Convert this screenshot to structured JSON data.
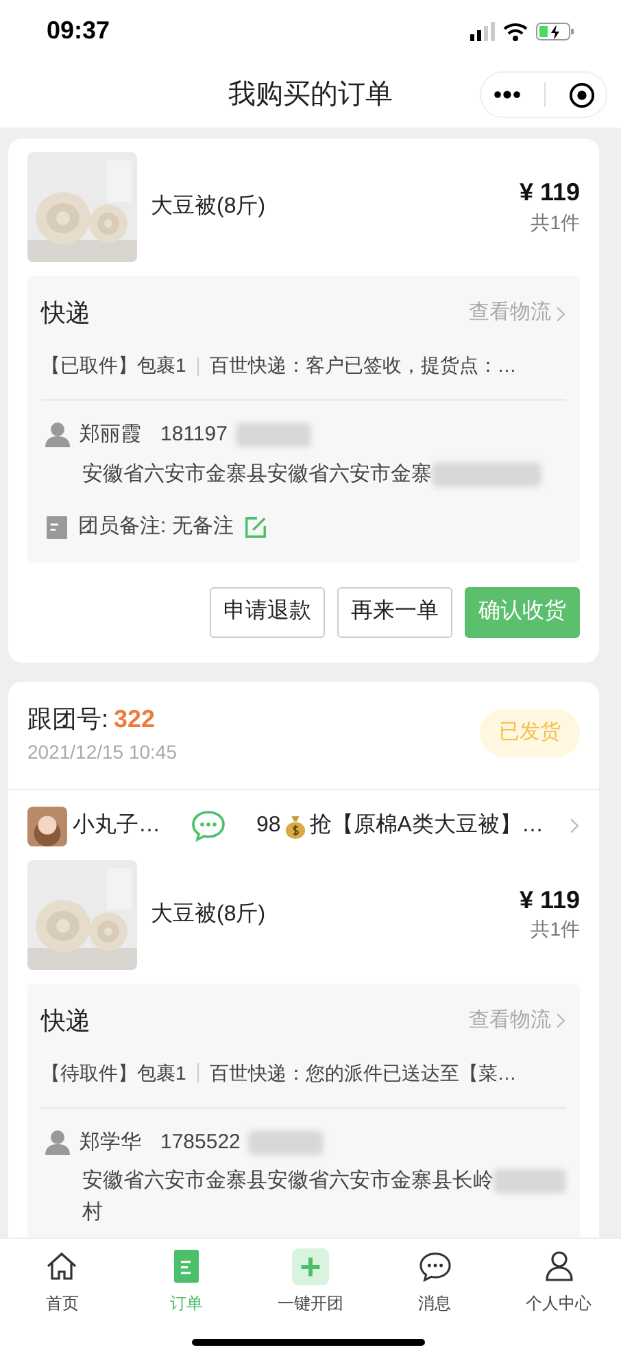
{
  "status_bar": {
    "time": "09:37"
  },
  "header": {
    "title": "我购买的订单"
  },
  "orders": [
    {
      "product": {
        "name": "大豆被(8斤)",
        "price": "¥ 119",
        "count": "共1件"
      },
      "express": {
        "title": "快递",
        "link": "查看物流",
        "status": "【已取件】包裹1",
        "detail": "百世快递：客户已签收，提货点：…",
        "name": "郑丽霞",
        "phone": "181197",
        "address": "安徽省六安市金寨县安徽省六安市金寨",
        "redacted": true,
        "note": "团员备注: 无备注"
      },
      "actions": [
        {
          "label": "申请退款",
          "kind": "outline"
        },
        {
          "label": "再来一单",
          "kind": "outline"
        },
        {
          "label": "确认收货",
          "kind": "primary"
        }
      ]
    },
    {
      "header": {
        "label": "跟团号:",
        "number": "322",
        "time": "2021/12/15 10:45",
        "status": "已发货"
      },
      "seller": {
        "name": "小丸子…",
        "price": "98",
        "title": "抢【原棉A类大豆被】…"
      },
      "product": {
        "name": "大豆被(8斤)",
        "price": "¥ 119",
        "count": "共1件"
      },
      "express": {
        "title": "快递",
        "link": "查看物流",
        "status": "【待取件】包裹1",
        "detail": "百世快递：您的派件已送达至【菜…",
        "name": "郑学华",
        "phone": "1785522",
        "address": "安徽省六安市金寨县安徽省六安市金寨县长岭",
        "address_more": "村",
        "redacted": true
      }
    }
  ],
  "tabs": [
    {
      "label": "首页",
      "kind": "home",
      "selected": false
    },
    {
      "label": "订单",
      "kind": "orders",
      "selected": true
    },
    {
      "label": "一键开团",
      "kind": "create",
      "selected": false
    },
    {
      "label": "消息",
      "kind": "messages",
      "selected": false
    },
    {
      "label": "个人中心",
      "kind": "profile",
      "selected": false
    }
  ]
}
